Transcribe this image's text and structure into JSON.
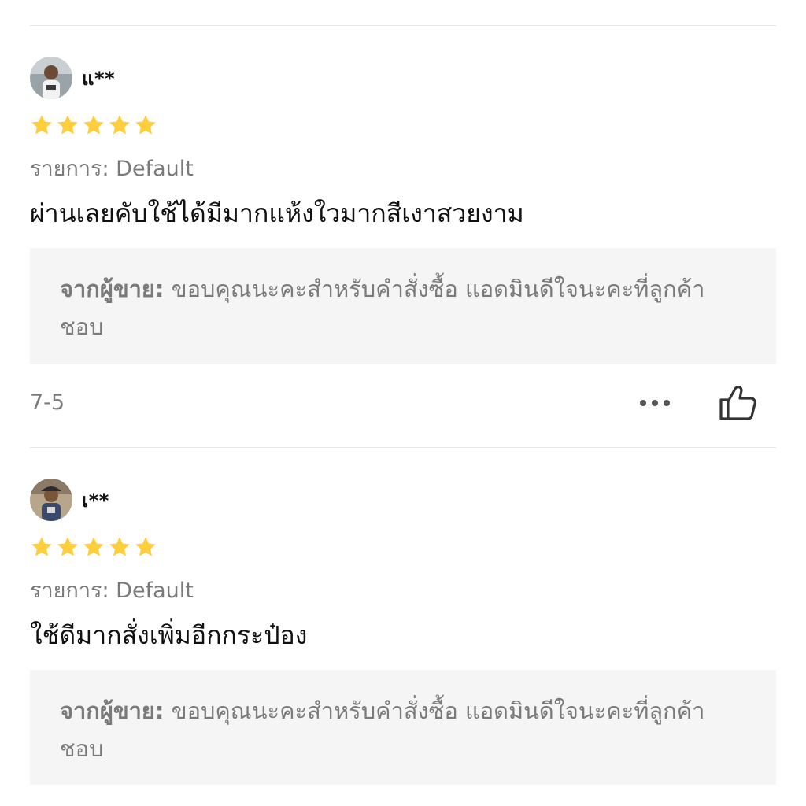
{
  "reviews": [
    {
      "username": "แ**",
      "rating": 5,
      "variant": "รายการ: Default",
      "comment": "ผ่านเลยคับใช้ได้มีมากแห้งใวมากสีเงาสวยงาม",
      "seller_label": "จากผู้ขาย:",
      "seller_reply": "ขอบคุณนะคะสำหรับคำสั่งซื้อ แอดมินดีใจนะคะที่ลูกค้าชอบ",
      "date": "7-5",
      "icons": {
        "more": "more-icon",
        "like": "thumbs-up-icon"
      }
    },
    {
      "username": "เ**",
      "rating": 5,
      "variant": "รายการ: Default",
      "comment": "ใช้ดีมากสั่งเพิ่มอีกกระป๋อง",
      "seller_label": "จากผู้ขาย:",
      "seller_reply": "ขอบคุณนะคะสำหรับคำสั่งซื้อ แอดมินดีใจนะคะที่ลูกค้าชอบ"
    }
  ],
  "colors": {
    "star": "#FFCE3D",
    "muted_text": "#7a7a7a",
    "reply_background": "#f5f5f5",
    "divider": "#e8e8e8"
  }
}
